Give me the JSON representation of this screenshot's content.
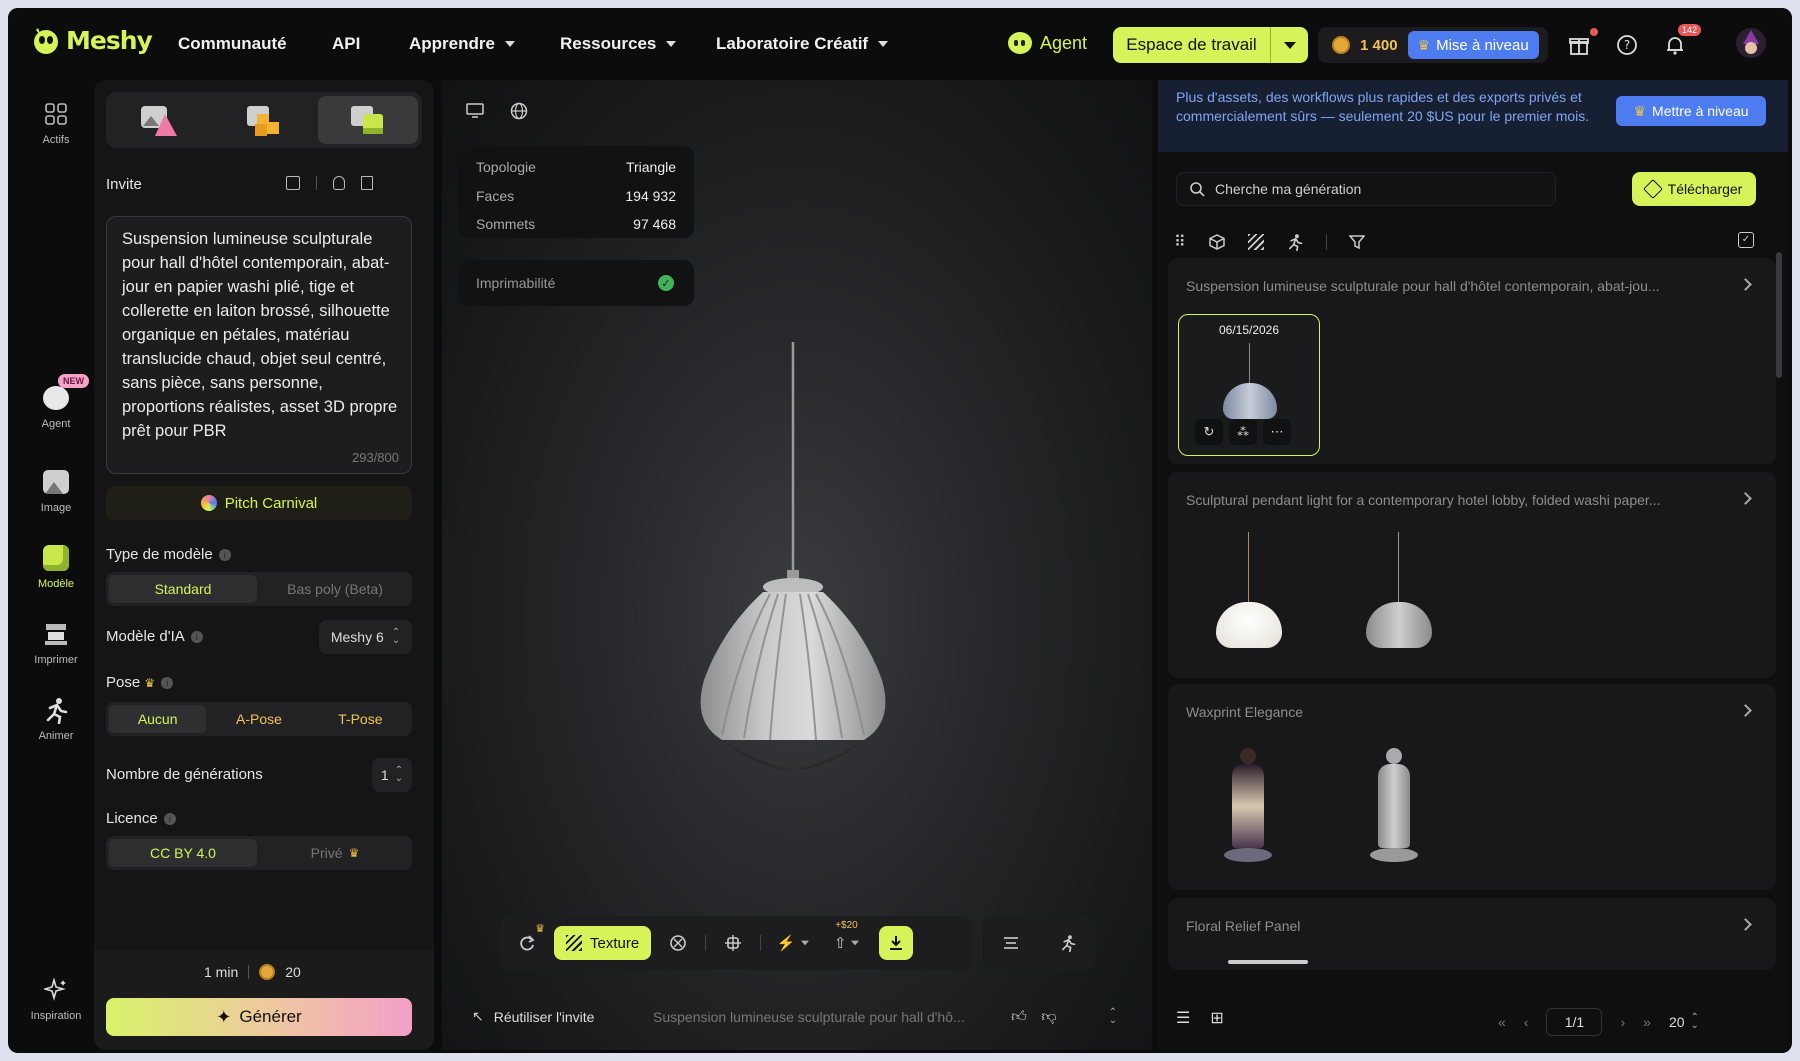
{
  "nav": {
    "logo_text": "Meshy",
    "links": [
      "Communauté",
      "API",
      "Apprendre",
      "Ressources",
      "Laboratoire Créatif"
    ],
    "agent_label": "Agent",
    "workspace_label": "Espace de travail",
    "credits": "1 400",
    "upgrade_label": "Mise à niveau",
    "notif_count": "142"
  },
  "rail": {
    "items": [
      "Actifs",
      "Agent",
      "Image",
      "Modèle",
      "Imprimer",
      "Animer",
      "Inspiration"
    ],
    "new_badge": "NEW"
  },
  "left": {
    "prompt_label": "Invite",
    "prompt_text": "Suspension lumineuse sculpturale pour hall d'hôtel contemporain, abat-jour en papier washi plié, tige et collerette en laiton brossé, silhouette organique en pétales, matériau translucide chaud, objet seul centré, sans pièce, sans personne, proportions réalistes, asset 3D propre prêt pour PBR",
    "char_count": "293/800",
    "style_chip": "Pitch Carnival",
    "model_type_label": "Type de modèle",
    "model_types": [
      "Standard",
      "Bas poly (Beta)"
    ],
    "ai_model_label": "Modèle d'IA",
    "ai_model_value": "Meshy 6",
    "pose_label": "Pose",
    "poses": [
      "Aucun",
      "A-Pose",
      "T-Pose"
    ],
    "gen_count_label": "Nombre de générations",
    "gen_count_value": "1",
    "license_label": "Licence",
    "licenses": [
      "CC BY 4.0",
      "Privé"
    ],
    "time_estimate": "1 min",
    "cost": "20",
    "generate_label": "Générer"
  },
  "viewport": {
    "stats": [
      {
        "label": "Topologie",
        "value": "Triangle"
      },
      {
        "label": "Faces",
        "value": "194 932"
      },
      {
        "label": "Sommets",
        "value": "97 468"
      }
    ],
    "printability_label": "Imprimabilité",
    "texture_label": "Texture",
    "export_cost": "+$20",
    "reuse_label": "Réutiliser l'invite",
    "bottom_prompt": "Suspension lumineuse sculpturale pour hall d'hô..."
  },
  "right": {
    "promo_text": "Plus d'assets, des workflows plus rapides et des exports privés et commercialement sûrs — seulement 20 $US pour le premier mois.",
    "promo_button": "Mettre à niveau",
    "search_placeholder": "Cherche ma génération",
    "upload_label": "Télécharger",
    "cards": [
      {
        "title": "Suspension lumineuse sculpturale pour hall d'hôtel contemporain, abat-jou...",
        "date": "06/15/2026"
      },
      {
        "title": "Sculptural pendant light for a contemporary hotel lobby, folded washi paper..."
      },
      {
        "title": "Waxprint Elegance"
      },
      {
        "title": "Floral Relief Panel"
      }
    ],
    "page_value": "1/1",
    "page_size": "20"
  },
  "colors": {
    "accent": "#d6f35a",
    "upgrade_blue": "#4d7cf0",
    "panel": "#151516",
    "background": "#0c0c0d"
  }
}
